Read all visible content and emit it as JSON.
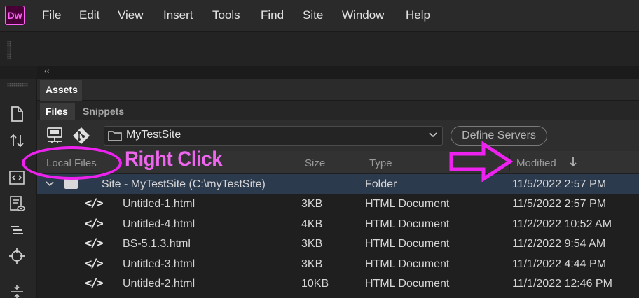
{
  "app": {
    "logo_text": "Dw",
    "logo_color": "#ff61f6"
  },
  "menu": [
    "File",
    "Edit",
    "View",
    "Insert",
    "Tools",
    "Find",
    "Site",
    "Window",
    "Help"
  ],
  "panel": {
    "collapse_glyph": "‹‹",
    "assets_tab": "Assets",
    "files_tab": "Files",
    "snippets_tab": "Snippets"
  },
  "site_selector": {
    "value": "MyTestSite",
    "define_servers_label": "Define Servers"
  },
  "columns": {
    "local_files": "Local Files",
    "size": "Size",
    "type": "Type",
    "modified": "Modified"
  },
  "annotation": {
    "text": "Right Click",
    "color": "#ee22ee"
  },
  "files": [
    {
      "name": "Site - MyTestSite (C:\\myTestSite)",
      "size": "",
      "type": "Folder",
      "modified": "11/5/2022 2:57 PM",
      "is_site": true
    },
    {
      "name": "Untitled-1.html",
      "size": "3KB",
      "type": "HTML Document",
      "modified": "11/5/2022 2:57 PM"
    },
    {
      "name": "Untitled-4.html",
      "size": "4KB",
      "type": "HTML Document",
      "modified": "11/2/2022 10:52 AM"
    },
    {
      "name": "BS-5.1.3.html",
      "size": "3KB",
      "type": "HTML Document",
      "modified": "11/2/2022 9:54 AM"
    },
    {
      "name": "Untitled-3.html",
      "size": "3KB",
      "type": "HTML Document",
      "modified": "11/1/2022 4:44 PM"
    },
    {
      "name": "Untitled-2.html",
      "size": "10KB",
      "type": "HTML Document",
      "modified": "11/1/2022 12:46 PM"
    }
  ]
}
